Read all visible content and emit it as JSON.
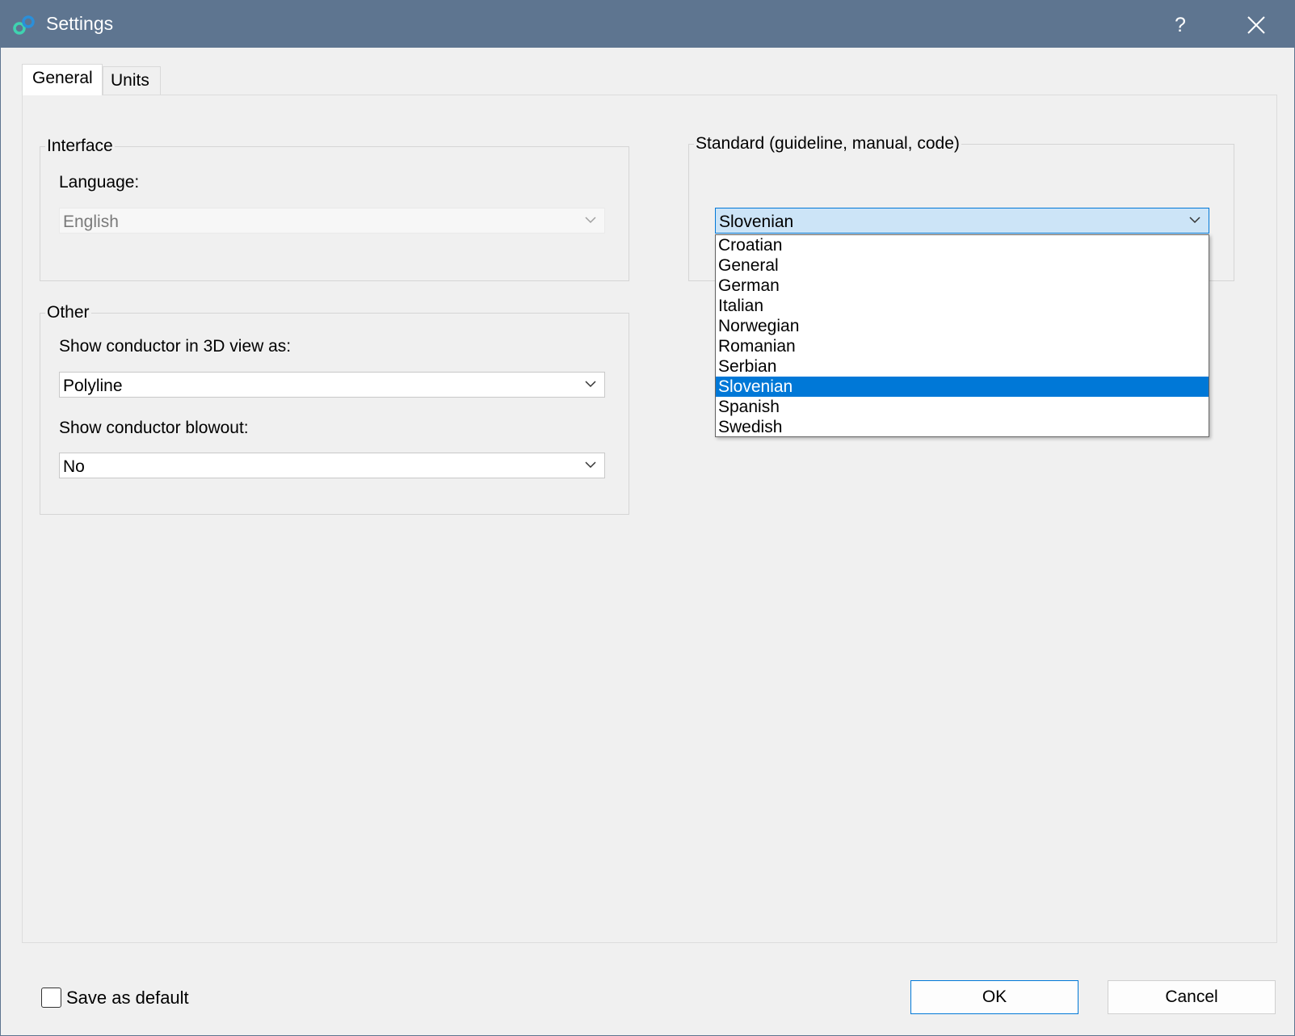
{
  "window": {
    "title": "Settings",
    "help_symbol": "?",
    "icons": {
      "app": "app-logo-icon",
      "close": "close-icon"
    },
    "colors": {
      "titlebar": "#5e7590",
      "selection": "#0078d7",
      "focus": "#cce4f7"
    }
  },
  "tabs": [
    {
      "label": "General",
      "active": true
    },
    {
      "label": "Units",
      "active": false
    }
  ],
  "interface_group": {
    "title": "Interface",
    "language_label": "Language:",
    "language_value": "English"
  },
  "other_group": {
    "title": "Other",
    "conductor_view_label": "Show conductor in 3D view as:",
    "conductor_view_value": "Polyline",
    "blowout_label": "Show conductor blowout:",
    "blowout_value": "No"
  },
  "standard_group": {
    "title": "Standard (guideline, manual, code)",
    "selected": "Slovenian",
    "options": [
      "Croatian",
      "General",
      "German",
      "Italian",
      "Norwegian",
      "Romanian",
      "Serbian",
      "Slovenian",
      "Spanish",
      "Swedish"
    ]
  },
  "footer": {
    "save_default_label": "Save as default",
    "save_default_checked": false,
    "ok_label": "OK",
    "cancel_label": "Cancel"
  }
}
